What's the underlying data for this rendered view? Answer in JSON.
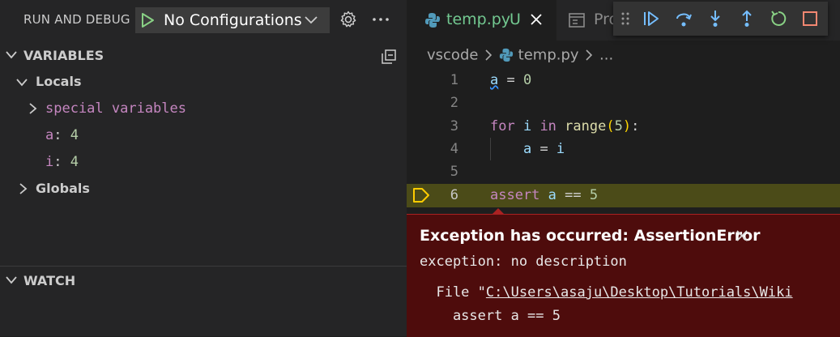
{
  "debug_panel": {
    "title": "RUN AND DEBUG",
    "configuration": "No Configurations",
    "icons": [
      "play-icon",
      "chevron-down-icon",
      "gear-icon",
      "more-icon"
    ]
  },
  "variables": {
    "title": "VARIABLES",
    "locals_label": "Locals",
    "special_label": "special variables",
    "items": [
      {
        "name": "a",
        "value": "4"
      },
      {
        "name": "i",
        "value": "4"
      }
    ],
    "globals_label": "Globals"
  },
  "watch": {
    "title": "WATCH"
  },
  "editor": {
    "tab_label": "temp.py",
    "tab_status": "U",
    "second_tab_label": "Pro",
    "breadcrumb": {
      "folder": "vscode",
      "file": "temp.py",
      "more": "..."
    },
    "debug_toolbar_icons": [
      "continue-icon",
      "step-over-icon",
      "step-into-icon",
      "step-out-icon",
      "restart-icon",
      "stop-icon"
    ],
    "lines": [
      {
        "number": "1"
      },
      {
        "number": "2"
      },
      {
        "number": "3"
      },
      {
        "number": "4"
      },
      {
        "number": "5"
      },
      {
        "number": "6"
      }
    ],
    "code": {
      "l1_var": "a",
      "l1_rest": " = ",
      "l1_num": "0",
      "l3_for": "for",
      "l3_i": " i ",
      "l3_in": "in",
      "l3_range": " range",
      "l3_open": "(",
      "l3_num": "5",
      "l3_close": ")",
      "l3_colon": ":",
      "l4_indent": "    ",
      "l4_a": "a",
      "l4_eq": " = ",
      "l4_i": "i",
      "l6_assert": "assert",
      "l6_a": " a",
      "l6_eq": " == ",
      "l6_num": "5"
    },
    "colors": {
      "current_line": "#4b4b18",
      "exception_bg": "#4e0c0c",
      "tab_modified": "#73c991"
    }
  },
  "exception": {
    "title": "Exception has occurred: AssertionError",
    "description": "exception: no description",
    "file_prefix": "  File \"",
    "file_path": "C:\\Users\\asaju\\Desktop\\Tutorials\\Wiki",
    "code_line": "    assert a == 5"
  }
}
